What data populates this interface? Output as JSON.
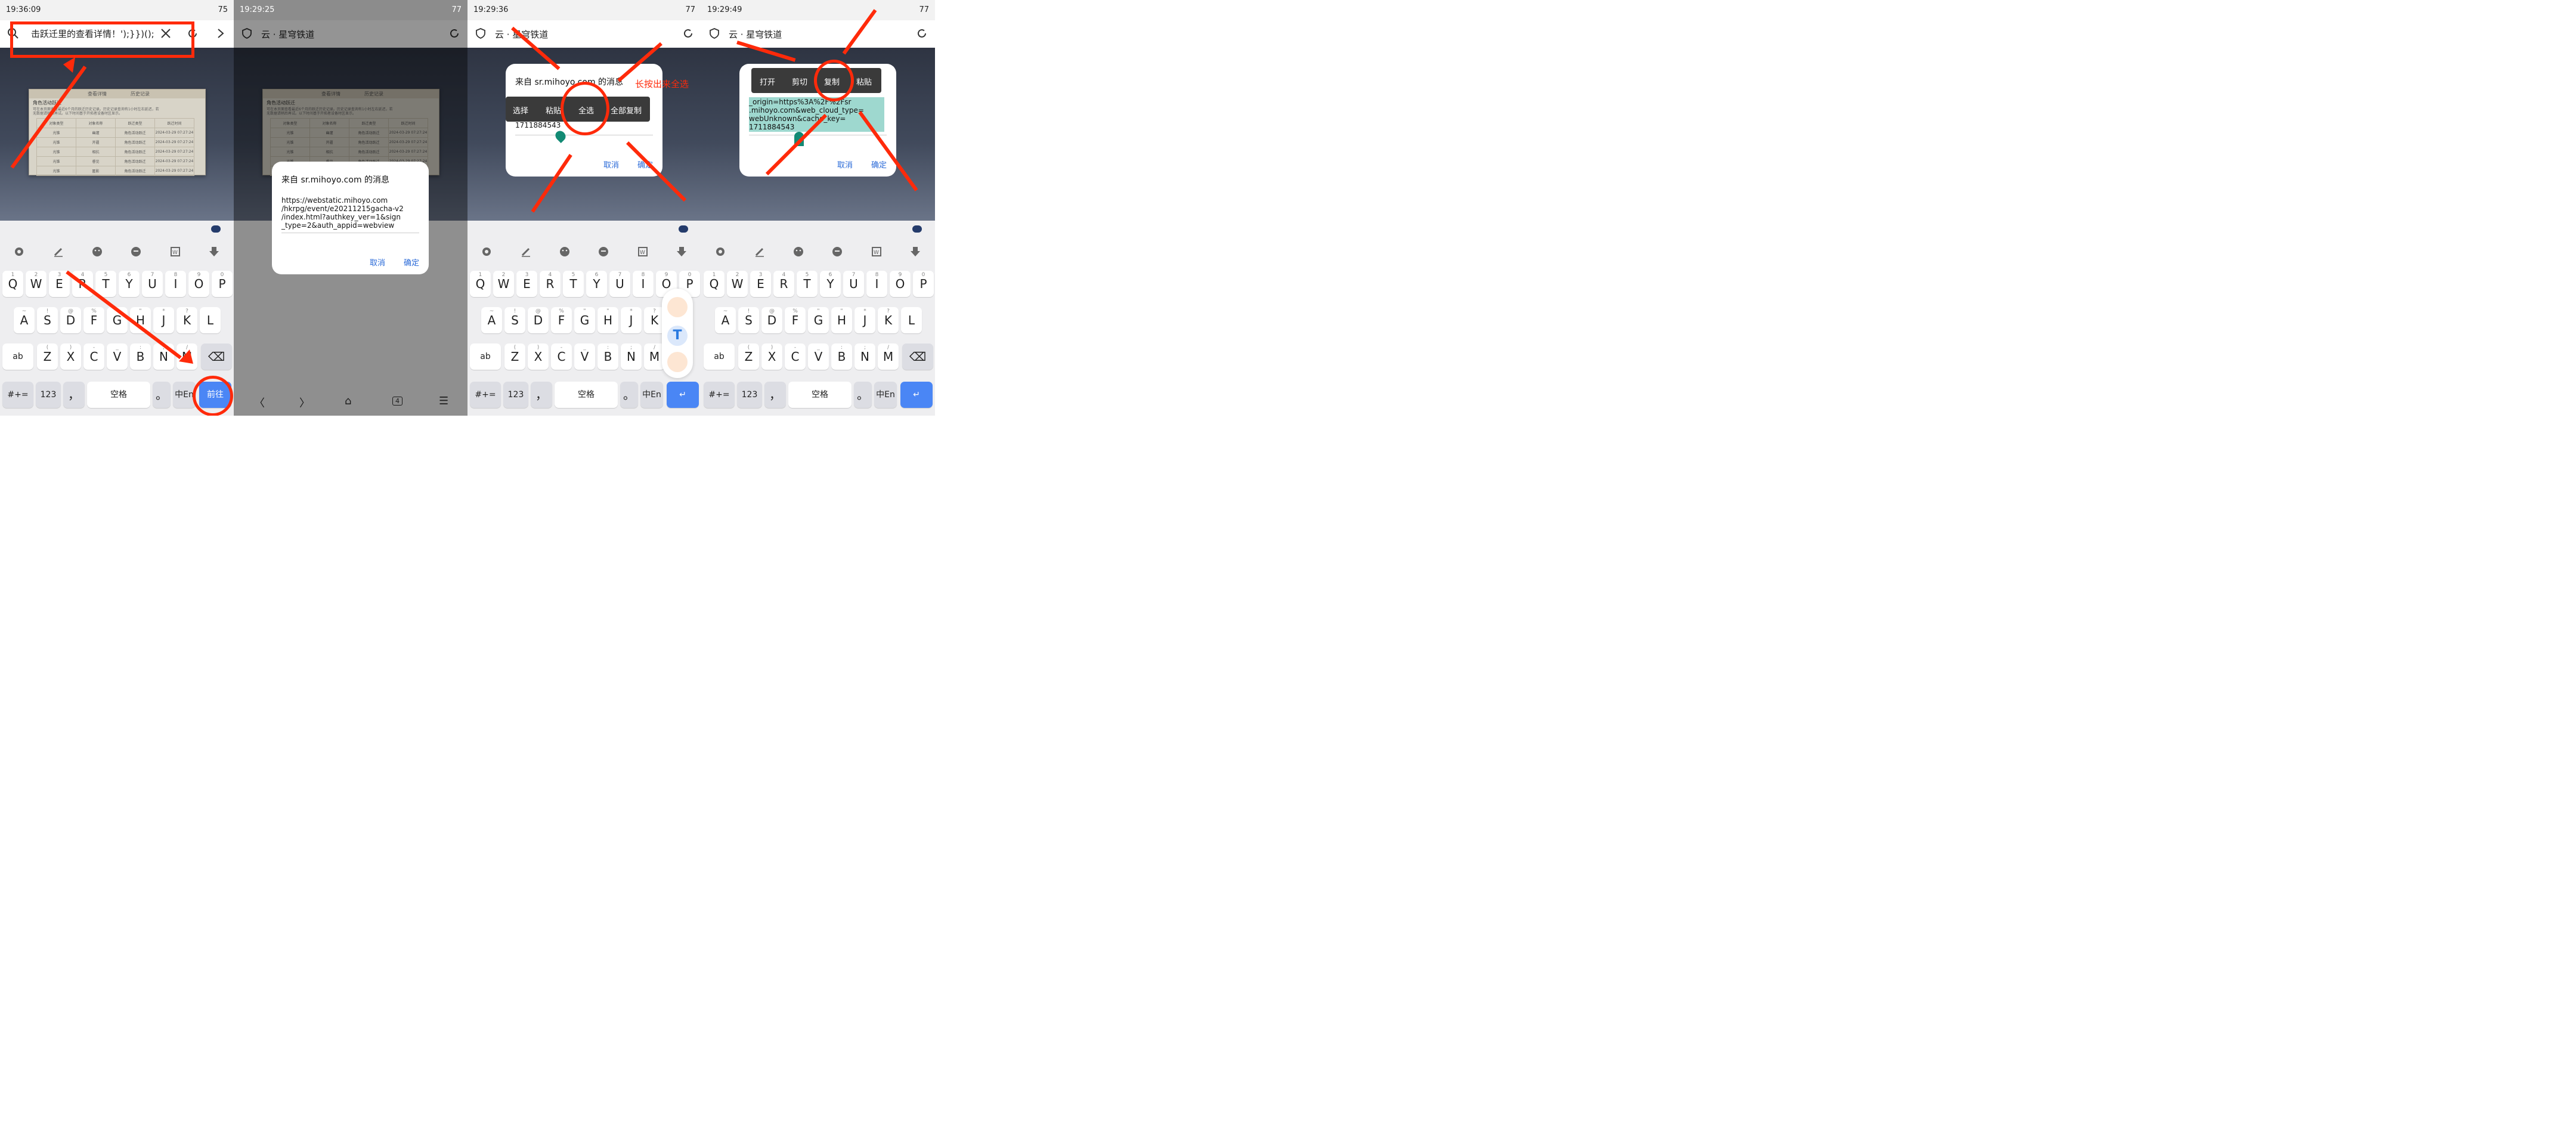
{
  "icons": {
    "search": "search-icon",
    "close": "close-icon",
    "reload": "reload-icon",
    "forward": "chevron-right-icon",
    "shield": "shield-icon",
    "settings": "gear-icon",
    "pen": "pen-icon",
    "emoji": "emoji-icon",
    "clip": "clipboard-icon",
    "word": "word-icon",
    "down": "download-icon"
  },
  "colors": {
    "annotation": "#ff2a0a",
    "enter_key": "#4a86f5",
    "dialog_button": "#2a6ad8",
    "selection": "#9ed8cf",
    "caret": "#128a74"
  },
  "panel1": {
    "time": "19:36:09",
    "battery": "75",
    "address_text": "击跃迁里的查看详情！');}})();"
  },
  "panel2": {
    "time": "19:29:25",
    "battery": "77",
    "page_title": "云 · 星穹铁道",
    "dialog": {
      "title": "来自  sr.mihoyo.com  的消息",
      "url_lines": [
        "https://webstatic.mihoyo.com",
        "/hkrpg/event/e20211215gacha-v2",
        "/index.html?authkey_ver=1&sign",
        "_type=2&auth_appid=webview"
      ],
      "cancel": "取消",
      "ok": "确定"
    }
  },
  "panel3": {
    "time": "19:29:36",
    "battery": "77",
    "page_title": "云 · 星穹铁道",
    "dialog": {
      "title": "来自  sr.mihoyo.com  的消息",
      "value": "1711884543",
      "cancel": "取消",
      "ok": "确定"
    },
    "menu": [
      "选择",
      "粘贴",
      "全选",
      "全部复制"
    ],
    "annotation": "长按出来全选"
  },
  "panel4": {
    "time": "19:29:49",
    "battery": "77",
    "page_title": "云 · 星穹铁道",
    "dialog": {
      "selected_lines": [
        "_origin=https%3A%2F%2Fsr",
        ".mihoyo.com&web_cloud_type=",
        "webUnknown&cache_key=",
        "1711884543"
      ],
      "cancel": "取消",
      "ok": "确定"
    },
    "menu": [
      "打开",
      "剪切",
      "复制",
      "粘贴"
    ]
  },
  "game_window": {
    "tab_left": "查看详情",
    "tab_right": "历史记录",
    "heading": "角色活动跃迁",
    "desc_1": "可在本页面查看最近6个月的跃迁历史记录。历史记录查询有1小时左右延迟，若",
    "desc_2": "无数据请稍后再试。以下时间基于开拓者设备时区显示。",
    "headers": [
      "对象类型",
      "对象名称",
      "跃迁类型",
      "跃迁时间"
    ],
    "rows": [
      [
        "光锥",
        "幽邃",
        "角色活动跃迁",
        "2024-03-29 07:27:24"
      ],
      [
        "光锥",
        "开疆",
        "角色活动跃迁",
        "2024-03-29 07:27:24"
      ],
      [
        "光锥",
        "相抗",
        "角色活动跃迁",
        "2024-03-29 07:27:24"
      ],
      [
        "光锥",
        "睿见",
        "角色活动跃迁",
        "2024-03-29 07:27:24"
      ],
      [
        "光锥",
        "匿影",
        "角色活动跃迁",
        "2024-03-29 07:27:24"
      ]
    ]
  },
  "keyboard": {
    "row1": [
      [
        "Q",
        "1"
      ],
      [
        "W",
        "2"
      ],
      [
        "E",
        "3"
      ],
      [
        "R",
        "4"
      ],
      [
        "T",
        "5"
      ],
      [
        "Y",
        "6"
      ],
      [
        "U",
        "7"
      ],
      [
        "I",
        "8"
      ],
      [
        "O",
        "9"
      ],
      [
        "P",
        "0"
      ]
    ],
    "row2": [
      [
        "A",
        "~"
      ],
      [
        "S",
        "!"
      ],
      [
        "D",
        "@"
      ],
      [
        "F",
        "%"
      ],
      [
        "G",
        "\""
      ],
      [
        "H",
        "\""
      ],
      [
        "J",
        "*"
      ],
      [
        "K",
        "?"
      ],
      [
        "L",
        ""
      ]
    ],
    "row3": [
      [
        "Z",
        "("
      ],
      [
        "X",
        ")"
      ],
      [
        "C",
        "-"
      ],
      [
        "V",
        "_"
      ],
      [
        "B",
        ":"
      ],
      [
        "N",
        ";"
      ],
      [
        "M",
        "/"
      ]
    ],
    "ab": "ab",
    "symbols": "#+=",
    "num": "123",
    "comma": "，",
    "space": "空格",
    "period": "。",
    "lang": "中En",
    "go": "前往",
    "backspace": "⌫",
    "enter": "↵"
  },
  "nav": {
    "back": "〈",
    "forward": "〉",
    "home": "⌂",
    "tabs": "4",
    "menu": "☰"
  },
  "floater": {
    "t_icon": "T"
  }
}
